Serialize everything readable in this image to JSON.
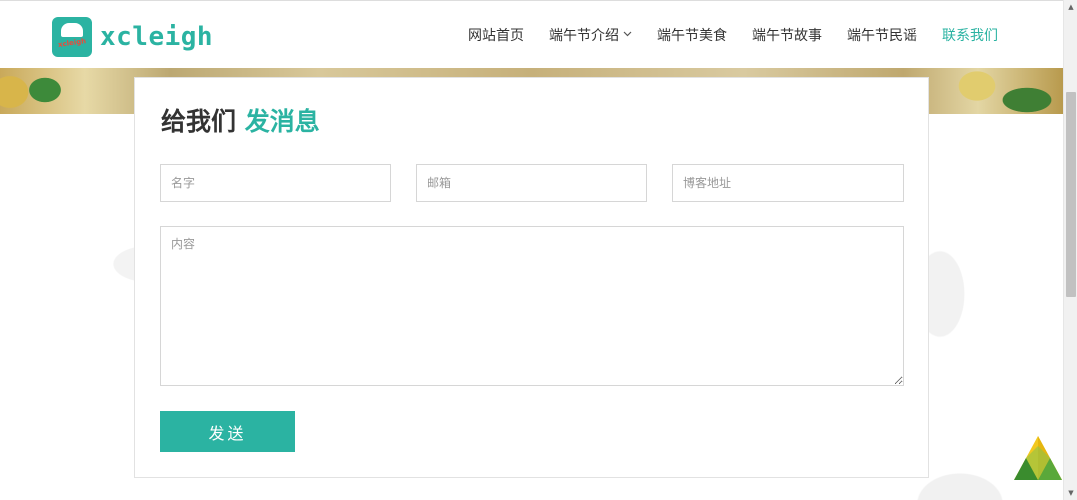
{
  "header": {
    "logo_text": "xcleigh",
    "logo_tag": "xcleigh",
    "nav": [
      {
        "label": "网站首页",
        "active": false
      },
      {
        "label": "端午节介绍",
        "active": false,
        "dropdown": true
      },
      {
        "label": "端午节美食",
        "active": false
      },
      {
        "label": "端午节故事",
        "active": false
      },
      {
        "label": "端午节民谣",
        "active": false
      },
      {
        "label": "联系我们",
        "active": true
      }
    ]
  },
  "form": {
    "title_prefix": "给我们",
    "title_accent": "发消息",
    "name_placeholder": "名字",
    "email_placeholder": "邮箱",
    "blog_placeholder": "博客地址",
    "content_placeholder": "内容",
    "send_label": "发送"
  },
  "colors": {
    "accent": "#2bb3a2",
    "text": "#333333"
  },
  "icons": {
    "dropdown": "chevron-down-icon",
    "back_to_top": "zongzi-icon"
  }
}
